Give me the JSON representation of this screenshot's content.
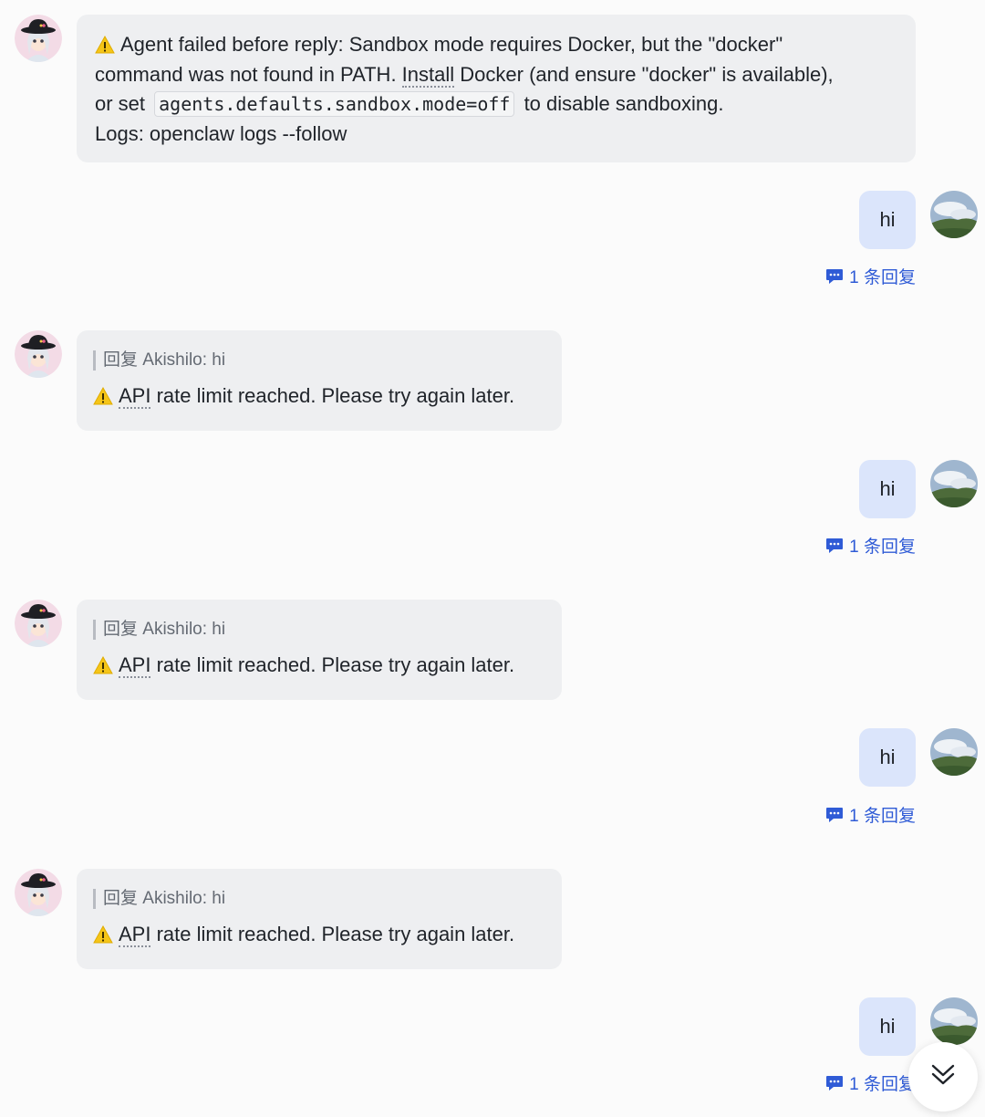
{
  "messages": [
    {
      "role": "bot",
      "error_parts": {
        "line1": "Agent failed before reply: Sandbox mode requires Docker, but the \"docker\"",
        "line2a": "command was not found in PATH. ",
        "line2b": "Install",
        "line2c": " Docker (and ensure \"docker\" is available),",
        "line3a": "or set ",
        "code": "agents.defaults.sandbox.mode=off",
        "line3b": " to disable sandboxing.",
        "line4": "Logs: openclaw logs --follow"
      }
    },
    {
      "role": "user",
      "text": "hi",
      "reply_count": "1 条回复"
    },
    {
      "role": "bot",
      "quote": "回复 Akishilo:  hi",
      "text_a": "API",
      "text_b": " rate limit reached. Please try again later."
    },
    {
      "role": "user",
      "text": "hi",
      "reply_count": "1 条回复"
    },
    {
      "role": "bot",
      "quote": "回复 Akishilo:  hi",
      "text_a": "API",
      "text_b": " rate limit reached. Please try again later."
    },
    {
      "role": "user",
      "text": "hi",
      "reply_count": "1 条回复"
    },
    {
      "role": "bot",
      "quote": "回复 Akishilo:  hi",
      "text_a": "API",
      "text_b": " rate limit reached. Please try again later."
    },
    {
      "role": "user",
      "text": "hi",
      "reply_count": "1 条回复"
    }
  ],
  "icons": {
    "warning": "warning-icon",
    "reply": "comment-bubble-icon",
    "scroll": "double-chevron-down-icon"
  },
  "colors": {
    "accent": "#2f5bd6",
    "bot_bubble": "#eeeff1",
    "user_bubble": "#dbe5fb",
    "warning": "#f5c518"
  }
}
